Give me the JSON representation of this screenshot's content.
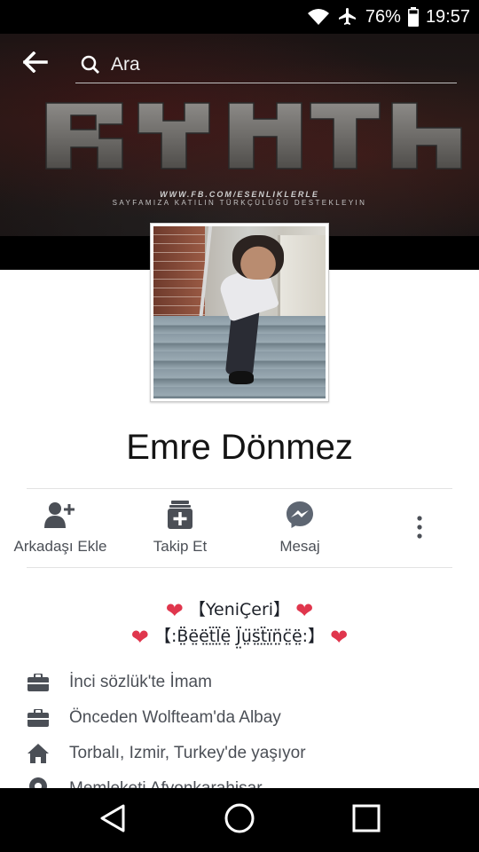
{
  "status_bar": {
    "battery_percent": "76%",
    "time": "19:57",
    "icons": [
      "wifi-icon",
      "airplane-mode-icon",
      "battery-icon"
    ]
  },
  "app_bar": {
    "back_icon": "arrow-left-icon",
    "search_icon": "search-icon",
    "search_placeholder": "Ara"
  },
  "cover": {
    "logo_text": "RYNh",
    "url_text": "WWW.FB.COM/ESENLIKLERLE",
    "tagline": "SAYFAMIZA KATILIN TÜRKÇÜLÜĞÜ DESTEKLEYIN"
  },
  "profile": {
    "name": "Emre Dönmez"
  },
  "actions": [
    {
      "label": "Arkadaşı Ekle",
      "icon": "add-friend-icon"
    },
    {
      "label": "Takip Et",
      "icon": "follow-icon"
    },
    {
      "label": "Mesaj",
      "icon": "messenger-icon"
    }
  ],
  "more_icon": "more-vertical-icon",
  "bio": {
    "line1": "【YeniÇeri】",
    "line2": "【:B̤̈ë̤ë̤ẗ̤l̤̈ë̤ J̤̈ṳ̈s̤̈ẗ̤ï̤n̤̈c̤̈ë̤:】",
    "heart_color": "#e0364d"
  },
  "info_items": [
    {
      "text": "İnci sözlük'te İmam",
      "icon": "briefcase-icon"
    },
    {
      "text": "Önceden Wolfteam'da Albay",
      "icon": "briefcase-icon"
    },
    {
      "text": "Torbalı, Izmir, Turkey'de yaşıyor",
      "icon": "home-icon"
    },
    {
      "text": "Memleketi Afyonkarahisar",
      "icon": "location-pin-icon"
    }
  ],
  "nav_bar": {
    "icons": [
      "back-triangle-icon",
      "home-circle-icon",
      "recents-square-icon"
    ]
  },
  "colors": {
    "icon_gray": "#4b4f56",
    "text_dark": "#141414",
    "messenger_icon": "#5e6672"
  }
}
